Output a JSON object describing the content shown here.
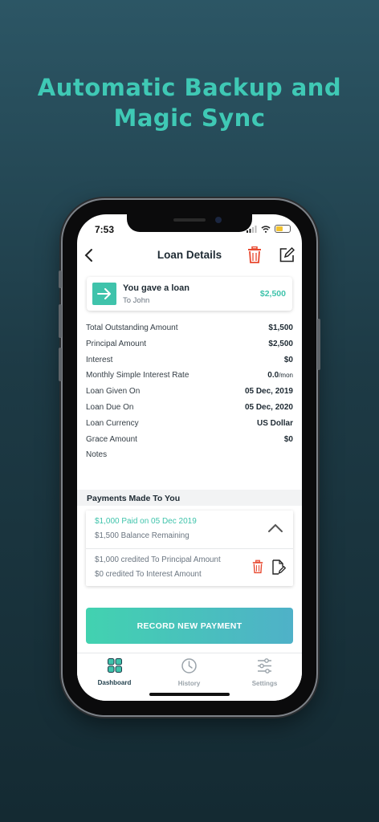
{
  "headline": {
    "line1": "Automatic Backup and",
    "line2": "Magic Sync"
  },
  "status_bar": {
    "time": "7:53",
    "icons": [
      "signal-icon",
      "wifi-icon",
      "battery-icon"
    ],
    "battery_color": "#f2c230"
  },
  "nav": {
    "title": "Loan Details",
    "back_icon": "chevron-left-icon",
    "delete_icon": "trash-icon",
    "edit_icon": "edit-icon"
  },
  "loan_card": {
    "title": "You gave a loan",
    "subtitle": "To John",
    "amount": "$2,500",
    "icon": "arrow-right-icon"
  },
  "details": [
    {
      "label": "Total Outstanding Amount",
      "value": "$1,500"
    },
    {
      "label": "Principal Amount",
      "value": "$2,500"
    },
    {
      "label": "Interest",
      "value": "$0"
    },
    {
      "label": "Monthly Simple Interest Rate",
      "value": "0.0",
      "unit": "/mon"
    },
    {
      "label": "Loan Given On",
      "value": "05 Dec, 2019"
    },
    {
      "label": "Loan Due On",
      "value": "05 Dec, 2020"
    },
    {
      "label": "Loan Currency",
      "value": "US Dollar"
    },
    {
      "label": "Grace Amount",
      "value": "$0"
    },
    {
      "label": "Notes",
      "value": ""
    }
  ],
  "payments": {
    "header": "Payments Made To You",
    "items": [
      {
        "paid": "$1,000 Paid on 05 Dec 2019",
        "balance": "$1,500 Balance Remaining",
        "principal_credit": "$1,000 credited To Principal Amount",
        "interest_credit": "$0 credited To Interest Amount"
      }
    ]
  },
  "record_button": "RECORD NEW PAYMENT",
  "tabs": [
    {
      "label": "Dashboard",
      "icon": "grid-icon",
      "active": true
    },
    {
      "label": "History",
      "icon": "clock-icon",
      "active": false
    },
    {
      "label": "Settings",
      "icon": "sliders-icon",
      "active": false
    }
  ],
  "colors": {
    "accent": "#3fc3ab",
    "headline": "#3fc9b5",
    "delete": "#e8482f",
    "background_top": "#2c5665",
    "background_bottom": "#142a32"
  }
}
